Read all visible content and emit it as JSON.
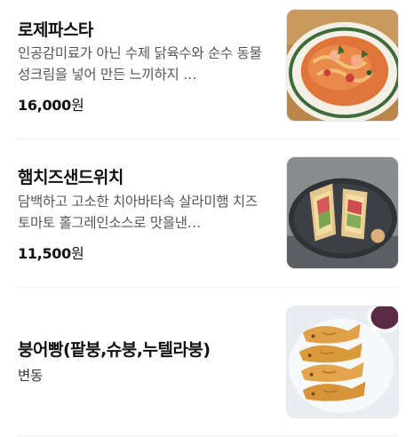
{
  "menu": {
    "items": [
      {
        "name": "로제파스타",
        "description": "인공감미료가 아닌 수제 닭육수와 순수 동물성크림을 넣어 만든 느끼하지 …",
        "price": "16,000",
        "currency": "원"
      },
      {
        "name": "햄치즈샌드위치",
        "description": "담백하고 고소한 치아바타속 살라미햄 치즈 토마토 홀그레인소스로 맛을낸…",
        "price": "11,500",
        "currency": "원"
      },
      {
        "name": "붕어빵(팥붕,슈붕,누텔라붕)",
        "price_text": "변동"
      }
    ]
  },
  "colors": {
    "text_primary": "#111111",
    "text_secondary": "#555555",
    "divider": "#eeeeee"
  }
}
